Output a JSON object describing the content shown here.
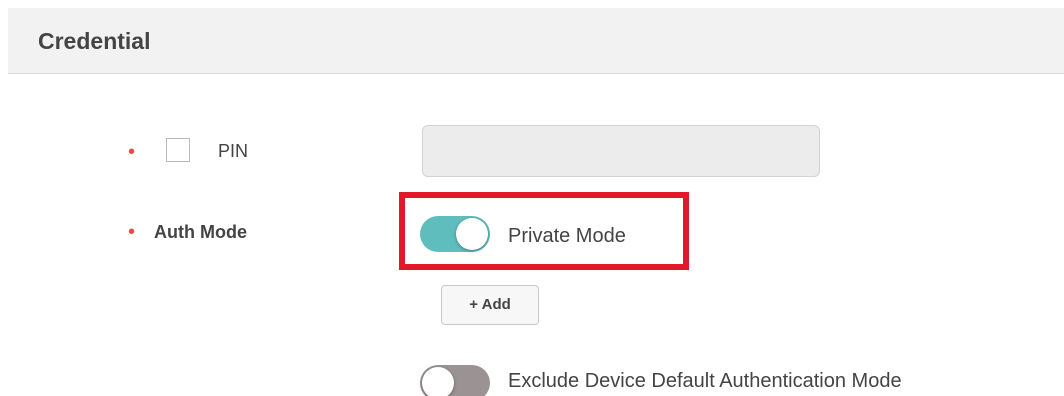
{
  "section": {
    "title": "Credential"
  },
  "pin": {
    "label": "PIN",
    "required_mark": "•",
    "value": ""
  },
  "auth_mode": {
    "label": "Auth Mode",
    "required_mark": "•",
    "private_mode_label": "Private Mode",
    "private_mode_enabled": true,
    "add_button_label": "+ Add",
    "exclude_default_label": "Exclude Device Default Authentication Mode",
    "exclude_default_enabled": false
  },
  "colors": {
    "required": "#e94e3c",
    "toggle_on": "#5fbdbd",
    "toggle_off": "#9a9293",
    "highlight": "#e01a2c"
  }
}
